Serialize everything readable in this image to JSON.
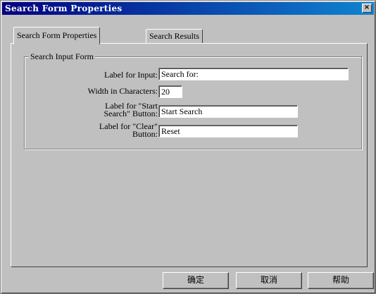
{
  "window": {
    "title": "Search Form Properties",
    "close_glyph": "×"
  },
  "tabs": [
    {
      "label": "Search Form Properties",
      "active": true
    },
    {
      "label": "Search Results",
      "active": false
    }
  ],
  "group": {
    "title": "Search Input Form",
    "fields": [
      {
        "label": "Label for Input:",
        "value": "Search for:"
      },
      {
        "label": "Width in Characters:",
        "value": "20"
      },
      {
        "label": "Label for \"Start\nSearch\" Button:",
        "value": "Start Search"
      },
      {
        "label": "Label for \"Clear\"\nButton:",
        "value": "Reset"
      }
    ]
  },
  "buttons": {
    "ok": "确定",
    "cancel": "取消",
    "help": "帮助"
  }
}
